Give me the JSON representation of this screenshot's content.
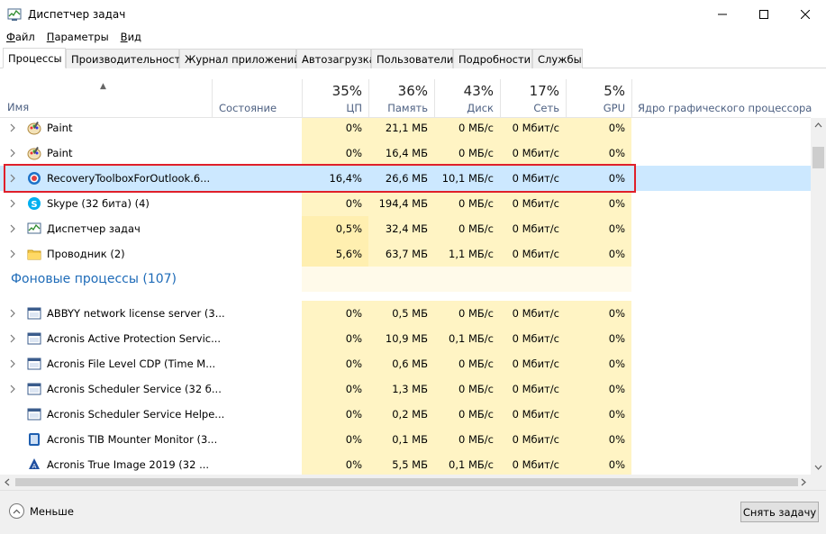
{
  "window": {
    "title": "Диспетчер задач",
    "controls": [
      "minimize",
      "maximize",
      "close"
    ]
  },
  "menu": [
    {
      "label": "Файл",
      "accel": "Ф",
      "rest": "айл"
    },
    {
      "label": "Параметры",
      "accel": "П",
      "rest": "араметры"
    },
    {
      "label": "Вид",
      "accel": "В",
      "rest": "ид"
    }
  ],
  "tabs": [
    {
      "label": "Процессы",
      "active": true
    },
    {
      "label": "Производительность"
    },
    {
      "label": "Журнал приложений"
    },
    {
      "label": "Автозагрузка"
    },
    {
      "label": "Пользователи"
    },
    {
      "label": "Подробности"
    },
    {
      "label": "Службы"
    }
  ],
  "header": {
    "name": "Имя",
    "state": "Состояние",
    "cpu": {
      "pct": "35%",
      "label": "ЦП"
    },
    "memory": {
      "pct": "36%",
      "label": "Память"
    },
    "disk": {
      "pct": "43%",
      "label": "Диск"
    },
    "network": {
      "pct": "17%",
      "label": "Сеть"
    },
    "gpu": {
      "pct": "5%",
      "label": "GPU"
    },
    "gpu_engine": "Ядро графического процессора"
  },
  "apps": [
    {
      "name": "Paint",
      "icon": "paint-icon",
      "cpu": "0%",
      "mem": "21,1 МБ",
      "disk": "0 МБ/с",
      "net": "0 Мбит/с",
      "gpu": "0%"
    },
    {
      "name": "Paint",
      "icon": "paint-icon",
      "cpu": "0%",
      "mem": "16,4 МБ",
      "disk": "0 МБ/с",
      "net": "0 Мбит/с",
      "gpu": "0%"
    },
    {
      "name": "RecoveryToolboxForOutlook.6...",
      "icon": "recovery-toolbox-icon",
      "cpu": "16,4%",
      "mem": "26,6 МБ",
      "disk": "10,1 МБ/с",
      "net": "0 Мбит/с",
      "gpu": "0%",
      "selected": true
    },
    {
      "name": "Skype (32 бита) (4)",
      "icon": "skype-icon",
      "cpu": "0%",
      "mem": "194,4 МБ",
      "disk": "0 МБ/с",
      "net": "0 Мбит/с",
      "gpu": "0%"
    },
    {
      "name": "Диспетчер задач",
      "icon": "task-manager-icon",
      "cpu": "0,5%",
      "mem": "32,4 МБ",
      "disk": "0 МБ/с",
      "net": "0 Мбит/с",
      "gpu": "0%"
    },
    {
      "name": "Проводник (2)",
      "icon": "explorer-folder-icon",
      "cpu": "5,6%",
      "mem": "63,7 МБ",
      "disk": "1,1 МБ/с",
      "net": "0 Мбит/с",
      "gpu": "0%"
    }
  ],
  "background_group": "Фоновые процессы (107)",
  "background": [
    {
      "name": "ABBYY network license server (3...",
      "icon": "service-icon",
      "expand": true,
      "cpu": "0%",
      "mem": "0,5 МБ",
      "disk": "0 МБ/с",
      "net": "0 Мбит/с",
      "gpu": "0%"
    },
    {
      "name": "Acronis Active Protection Servic...",
      "icon": "service-icon",
      "expand": true,
      "cpu": "0%",
      "mem": "10,9 МБ",
      "disk": "0,1 МБ/с",
      "net": "0 Мбит/с",
      "gpu": "0%"
    },
    {
      "name": "Acronis File Level CDP (Time M...",
      "icon": "service-icon",
      "expand": true,
      "cpu": "0%",
      "mem": "0,6 МБ",
      "disk": "0 МБ/с",
      "net": "0 Мбит/с",
      "gpu": "0%"
    },
    {
      "name": "Acronis Scheduler Service (32 б...",
      "icon": "service-icon",
      "expand": true,
      "cpu": "0%",
      "mem": "1,3 МБ",
      "disk": "0 МБ/с",
      "net": "0 Мбит/с",
      "gpu": "0%"
    },
    {
      "name": "Acronis Scheduler Service Helpe...",
      "icon": "service-icon",
      "expand": false,
      "cpu": "0%",
      "mem": "0,2 МБ",
      "disk": "0 МБ/с",
      "net": "0 Мбит/с",
      "gpu": "0%"
    },
    {
      "name": "Acronis TIB Mounter Monitor (3...",
      "icon": "tib-mounter-icon",
      "expand": false,
      "cpu": "0%",
      "mem": "0,1 МБ",
      "disk": "0 МБ/с",
      "net": "0 Мбит/с",
      "gpu": "0%"
    },
    {
      "name": "Acronis True Image 2019 (32 ...",
      "icon": "acronis-true-image-icon",
      "expand": false,
      "cpu": "0%",
      "mem": "5,5 МБ",
      "disk": "0,1 МБ/с",
      "net": "0 Мбит/с",
      "gpu": "0%"
    }
  ],
  "footer": {
    "less_label": "Меньше",
    "end_task_label": "Снять задачу"
  },
  "colors": {
    "heat_light": "#fff4c4",
    "heat_mid": "#ffefb0",
    "selected_row": "#cce8ff",
    "highlight_border": "#e0202a",
    "group_title": "#1e6bb8"
  }
}
